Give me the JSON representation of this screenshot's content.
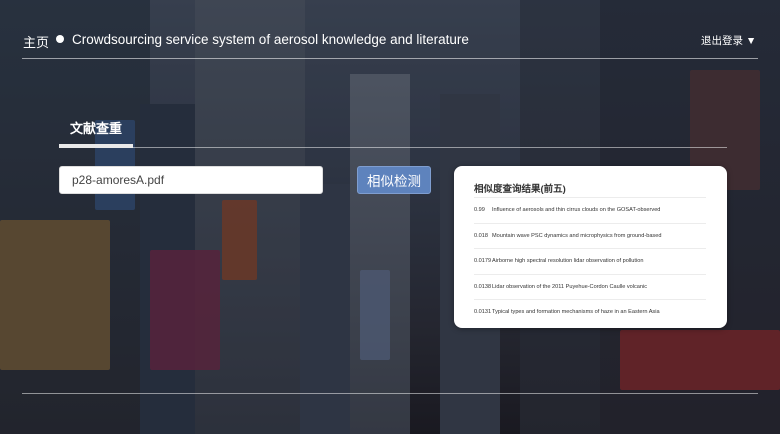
{
  "header": {
    "home_label": "主页",
    "title": "Crowdsourcing service system of aerosol knowledge and literature",
    "logout_label": "退出登录 ▼"
  },
  "section": {
    "title": "文献查重"
  },
  "upload": {
    "file_value": "p28-amoresA.pdf",
    "detect_button_label": "相似检测"
  },
  "results_panel": {
    "title": "相似度查询结果(前五)",
    "items": [
      {
        "score": "0.99",
        "paper": "Influence of aerosols and thin cirrus clouds on the GOSAT-observed"
      },
      {
        "score": "0.018",
        "paper": "Mountain wave PSC dynamics and microphysics from ground-based"
      },
      {
        "score": "0.0179",
        "paper": "Airborne high spectral resolution lidar observation of pollution"
      },
      {
        "score": "0.0138",
        "paper": "Lidar observation of the 2011 Puyehue-Cordon Caulle volcanic"
      },
      {
        "score": "0.0131",
        "paper": "Typical types and formation mechanisms of haze in an Eastern Asia"
      }
    ]
  }
}
